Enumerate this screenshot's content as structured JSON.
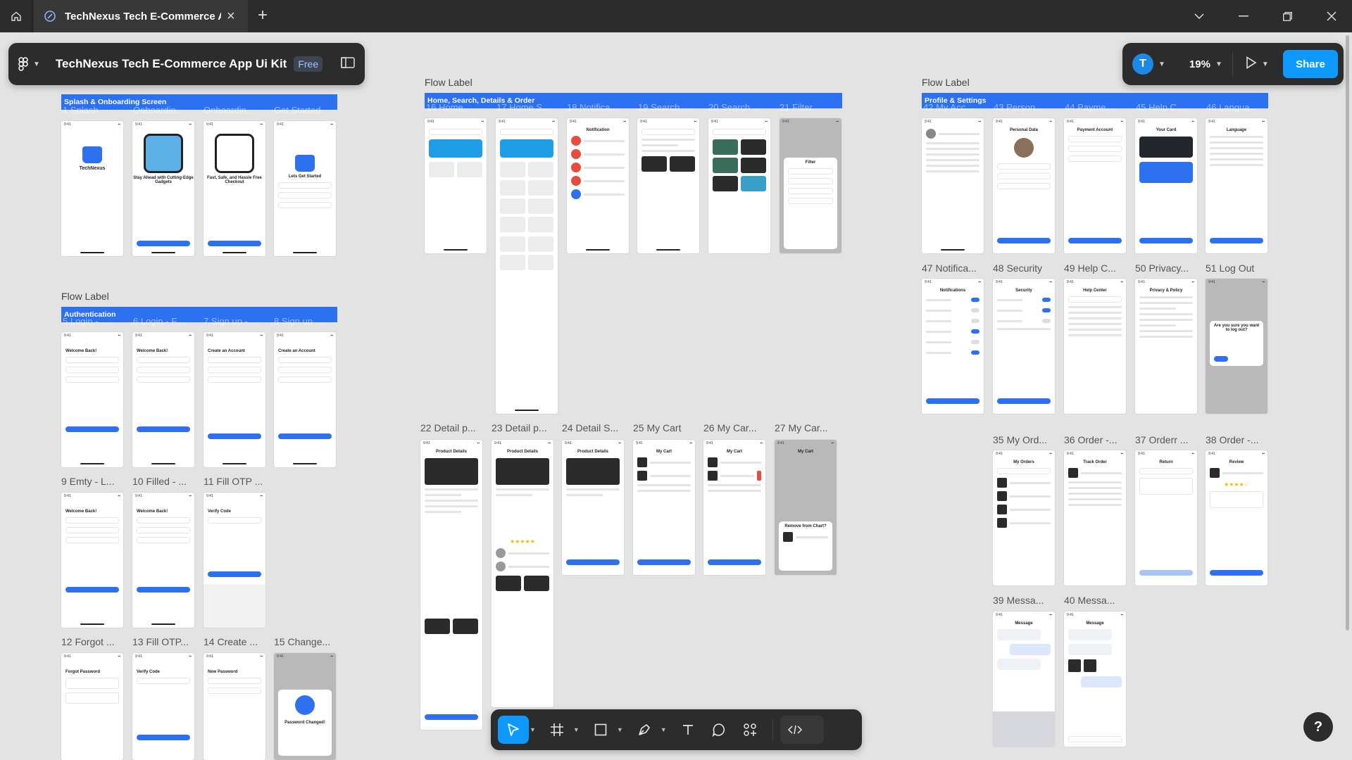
{
  "browser": {
    "tab_title": "TechNexus Tech E-Commerce Ap",
    "icons": [
      "home-icon",
      "figma-tab-icon",
      "close-icon",
      "plus-icon",
      "chevron-down-icon",
      "minimize-icon",
      "restore-icon",
      "close-window-icon"
    ]
  },
  "file": {
    "title": "TechNexus Tech E-Commerce App Ui Kit",
    "badge": "Free"
  },
  "header_right": {
    "avatar_letter": "T",
    "zoom": "19%",
    "share_label": "Share"
  },
  "toolbar": {
    "tools": [
      "move",
      "frame",
      "rectangle",
      "pen",
      "text",
      "comment",
      "actions",
      "dev-mode"
    ]
  },
  "help_label": "?",
  "colors": {
    "canvas_bg": "#e3e3e3",
    "panel_bg": "#2c2c2c",
    "accent_blue": "#0d99ff",
    "section_blue": "#2e71f0"
  },
  "canvas": {
    "flow_labels": [
      "Flow Label",
      "Flow Label",
      "Flow Label"
    ],
    "sections": {
      "splash": "Splash & Onboarding Screen",
      "authentication": "Authentication",
      "home": "Home, Search, Details & Order",
      "profile": "Profile & Settings"
    },
    "frames": {
      "f1": "1 Splash",
      "f2": "Onboardin...",
      "f3": "Onboardin...",
      "f4": "Get Started",
      "f5": "5 Login - ...",
      "f6": "6 Login - F...",
      "f7": "7 Sign up - ...",
      "f8": "8 Sign up ...",
      "f9": "9 Emty - L...",
      "f10": "10 Filled - ...",
      "f11": "11 Fill OTP ...",
      "f12": "12 Forgot ...",
      "f13": "13 Fill OTP...",
      "f14": "14 Create ...",
      "f15": "15 Change...",
      "f16": "16 Home",
      "f17": "17 Home S...",
      "f18": "18 Notifica...",
      "f19": "19 Search ...",
      "f20": "20 Search ...",
      "f21": "21 Filter",
      "f22": "22 Detail p...",
      "f23": "23 Detail p...",
      "f24": "24 Detail S...",
      "f25": "25 My Cart",
      "f26": "26 My Car...",
      "f27": "27 My Car...",
      "f35": "35 My Ord...",
      "f36": "36 Order -...",
      "f37": "37 Orderr ...",
      "f38": "38 Order -...",
      "f39": "39 Messa...",
      "f40": "40 Messa...",
      "f42": "42 My Acc...",
      "f43": "43 Person...",
      "f44": "44 Payme...",
      "f45": "45 Help C...",
      "f46": "46 Langua...",
      "f47": "47 Notifica...",
      "f48": "48 Security",
      "f49": "49 Help C...",
      "f50": "50 Privacy...",
      "f51": "51 Log Out"
    },
    "screens": {
      "welcome": "Welcome Back!",
      "create": "Create an Account",
      "verify": "Verify Code",
      "forgot": "Forgot Password",
      "new_password": "New Password",
      "password_changed": "Password Changed!",
      "lets_start": "Lets Get Started",
      "brand": "TechNexus",
      "onb1": "Stay Ahead with Cutting-Edge Gadgets",
      "onb2": "Fast, Safe, and Hassle Free Checkout",
      "product_details": "Product Details",
      "my_cart": "My Cart",
      "my_orders": "My Orders",
      "track_order": "Track Order",
      "notification": "Notification",
      "filter": "Filter",
      "message": "Message",
      "personal_data": "Personal Data",
      "payment_account": "Payment Account",
      "your_card": "Your Card",
      "language": "Language",
      "notifications": "Notifications",
      "security": "Security",
      "help_center": "Help Center",
      "privacy": "Privacy & Policy",
      "logout_prompt": "Are you sure you want to log out?",
      "review": "Review",
      "return": "Return",
      "remove_cart": "Remove from Chart?"
    }
  }
}
